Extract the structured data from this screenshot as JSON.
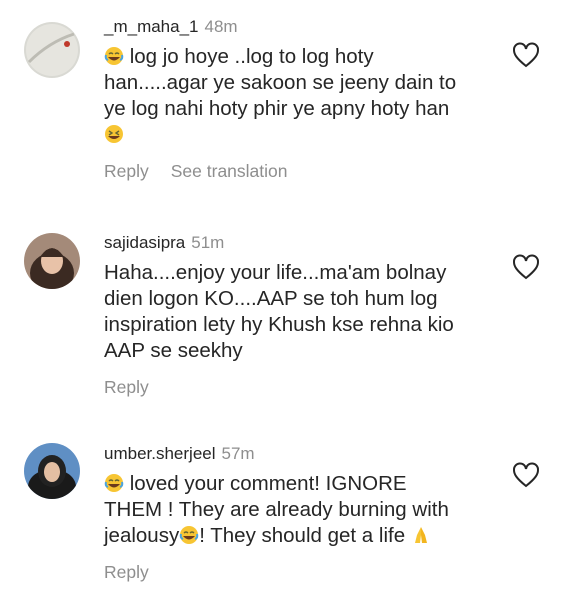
{
  "comments": [
    {
      "username": "_m_maha_1",
      "time": "48m",
      "text_before_emoji": "",
      "text_lines": [
        "log jo hoye ..log to log hoty",
        "han.....agar ye sakoon se jeeny dain to",
        "ye log nahi hoty phir ye apny hoty han"
      ],
      "reply_label": "Reply",
      "translation_label": "See translation"
    },
    {
      "username": "sajidasipra",
      "time": "51m",
      "text_lines": [
        "Haha....enjoy your life...ma'am bolnay",
        "dien logon KO....AAP se toh hum log",
        "inspiration lety hy Khush kse rehna kio",
        "AAP se seekhy"
      ],
      "reply_label": "Reply"
    },
    {
      "username": "umber.sherjeel",
      "time": "57m",
      "line1": "loved your comment! IGNORE",
      "line2": "THEM ! They are already burning with",
      "line3_a": "jealousy",
      "line3_b": "! They should get a life",
      "reply_label": "Reply"
    }
  ],
  "icons": {
    "like": "heart-outline-icon",
    "laugh_emoji": "face-with-tears-of-joy",
    "grin_emoji": "grinning-squinting-face",
    "pray_emoji": "folded-hands"
  },
  "colors": {
    "text": "#262626",
    "secondary": "#8e8e8e"
  }
}
